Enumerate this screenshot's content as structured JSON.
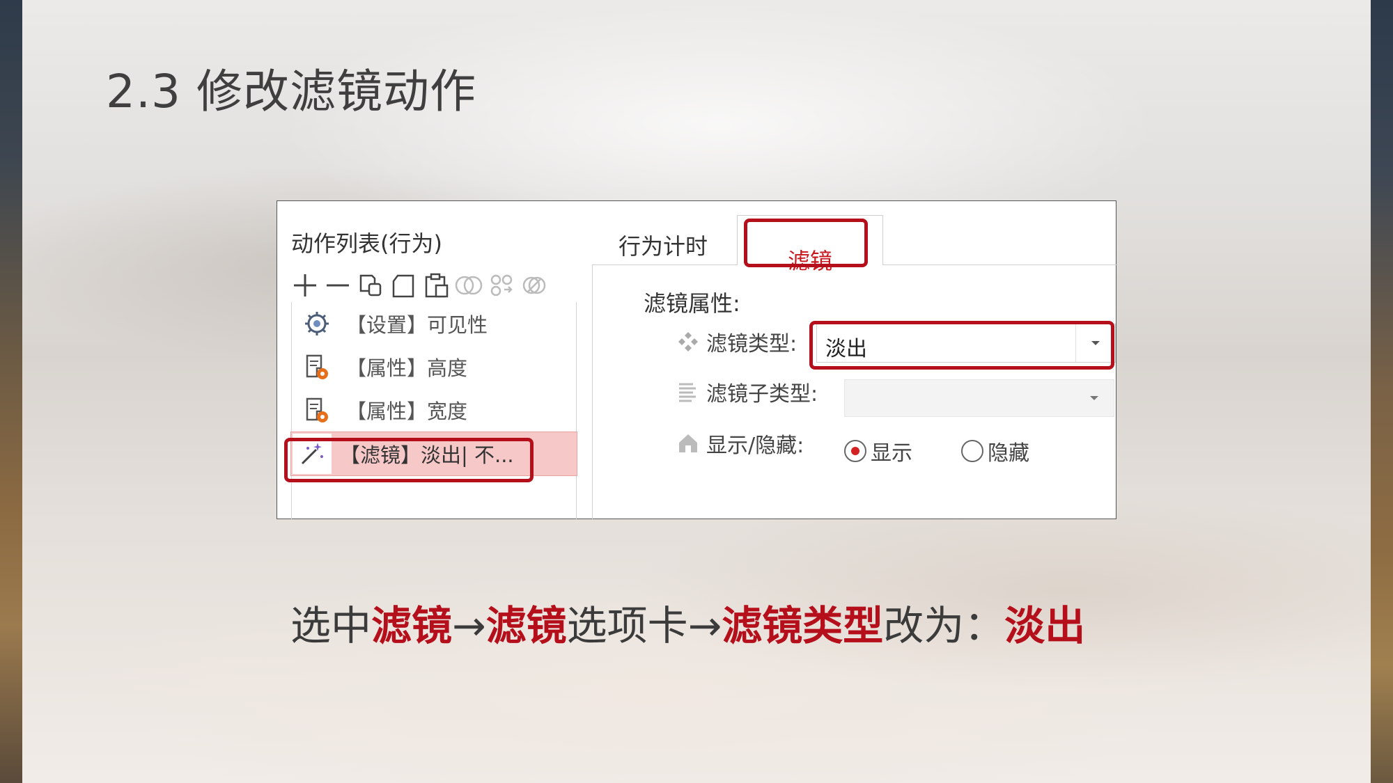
{
  "slide": {
    "title": "2.3 修改滤镜动作"
  },
  "left_panel": {
    "header": "动作列表(行为)",
    "toolbar": [
      "add-icon",
      "remove-icon",
      "copy-icon",
      "paste-icon",
      "paste-special-icon",
      "split-icon",
      "link-icon",
      "disabled-icon"
    ],
    "items": [
      {
        "label": "【设置】可见性",
        "icon": "gear-icon"
      },
      {
        "label": "【属性】高度",
        "icon": "property-icon"
      },
      {
        "label": "【属性】宽度",
        "icon": "property-icon"
      },
      {
        "label": "【滤镜】淡出| 不...",
        "icon": "magic-wand-icon",
        "selected": true
      }
    ]
  },
  "tabs": [
    {
      "label": "行为计时"
    },
    {
      "label": "滤镜",
      "active": true
    }
  ],
  "filter_props": {
    "heading": "滤镜属性:",
    "type_label": "滤镜类型:",
    "type_value": "淡出",
    "subtype_label": "滤镜子类型:",
    "subtype_value": "",
    "visibility_label": "显示/隐藏:",
    "show_label": "显示",
    "hide_label": "隐藏",
    "selected_visibility": "显示"
  },
  "caption": {
    "parts": [
      {
        "text": "选中",
        "em": false
      },
      {
        "text": "滤镜",
        "em": true
      },
      {
        "text": "→",
        "em": false
      },
      {
        "text": "滤镜",
        "em": true
      },
      {
        "text": "选项卡→",
        "em": false
      },
      {
        "text": "滤镜类型",
        "em": true
      },
      {
        "text": "改为：",
        "em": false
      },
      {
        "text": "淡出",
        "em": true
      }
    ]
  },
  "colors": {
    "highlight": "#b40f1a",
    "accent_red": "#c8161d",
    "selected_row": "#f7c8c8"
  }
}
